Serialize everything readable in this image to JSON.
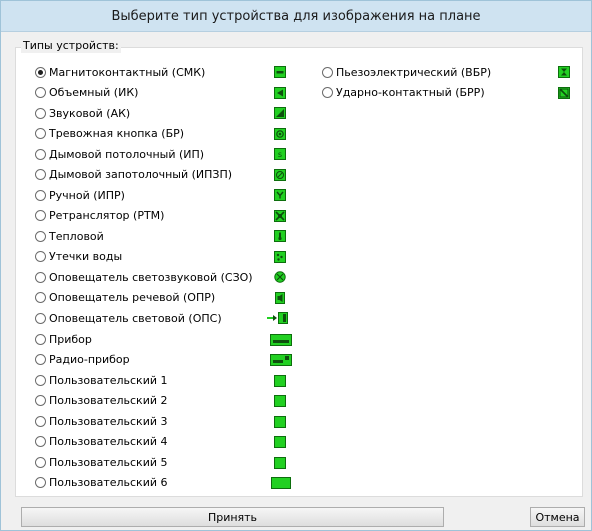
{
  "window": {
    "title": "Выберите тип устройства для изображения на плане"
  },
  "group": {
    "legend": "Типы устройств:"
  },
  "left_options": [
    {
      "label": "Магнитоконтактный (СМК)",
      "checked": true,
      "icon": "magnetic-contact-icon"
    },
    {
      "label": "Объемный (ИК)",
      "checked": false,
      "icon": "volumetric-ir-icon"
    },
    {
      "label": "Звуковой (АК)",
      "checked": false,
      "icon": "acoustic-icon"
    },
    {
      "label": "Тревожная кнопка (БР)",
      "checked": false,
      "icon": "panic-button-icon"
    },
    {
      "label": "Дымовой потолочный (ИП)",
      "checked": false,
      "icon": "ceiling-smoke-icon"
    },
    {
      "label": "Дымовой запотолочный (ИПЗП)",
      "checked": false,
      "icon": "above-ceiling-smoke-icon"
    },
    {
      "label": "Ручной (ИПР)",
      "checked": false,
      "icon": "manual-call-point-icon"
    },
    {
      "label": "Ретранслятор (РТМ)",
      "checked": false,
      "icon": "repeater-icon"
    },
    {
      "label": "Тепловой",
      "checked": false,
      "icon": "heat-detector-icon"
    },
    {
      "label": "Утечки воды",
      "checked": false,
      "icon": "water-leak-icon"
    },
    {
      "label": "Оповещатель светозвуковой (СЗО)",
      "checked": false,
      "icon": "light-sound-alarm-icon"
    },
    {
      "label": "Оповещатель речевой (ОПР)",
      "checked": false,
      "icon": "voice-alarm-icon"
    },
    {
      "label": "Оповещатель световой (ОПС)",
      "checked": false,
      "icon": "light-alarm-icon"
    },
    {
      "label": "Прибор",
      "checked": false,
      "icon": "device-icon"
    },
    {
      "label": "Радио-прибор",
      "checked": false,
      "icon": "radio-device-icon"
    },
    {
      "label": "Пользовательский 1",
      "checked": false,
      "icon": "custom-1-icon"
    },
    {
      "label": "Пользовательский 2",
      "checked": false,
      "icon": "custom-2-icon"
    },
    {
      "label": "Пользовательский 3",
      "checked": false,
      "icon": "custom-3-icon"
    },
    {
      "label": "Пользовательский 4",
      "checked": false,
      "icon": "custom-4-icon"
    },
    {
      "label": "Пользовательский 5",
      "checked": false,
      "icon": "custom-5-icon"
    },
    {
      "label": "Пользовательский 6",
      "checked": false,
      "icon": "custom-6-icon"
    }
  ],
  "right_options": [
    {
      "label": "Пьезоэлектрический (ВБР)",
      "checked": false,
      "icon": "piezo-icon"
    },
    {
      "label": "Ударно-контактный (БРР)",
      "checked": false,
      "icon": "shock-contact-icon"
    }
  ],
  "buttons": {
    "accept": "Принять",
    "cancel": "Отмена"
  },
  "colors": {
    "icon_fill": "#22d022",
    "icon_stroke": "#0d6e0d",
    "titlebar": "#cfe3f1"
  }
}
